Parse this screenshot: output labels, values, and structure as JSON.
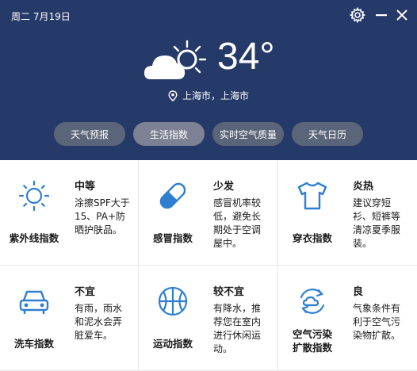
{
  "header": {
    "date": "周二 7月19日",
    "temperature": "34°",
    "location": "上海市，上海市"
  },
  "tabs": [
    {
      "label": "天气预报"
    },
    {
      "label": "生活指数"
    },
    {
      "label": "实时空气质量"
    },
    {
      "label": "天气日历"
    }
  ],
  "indices": [
    {
      "name": "紫外线指数",
      "level": "中等",
      "desc": "涂擦SPF大于15、PA+防晒护肤品。",
      "icon": "sun-icon"
    },
    {
      "name": "感冒指数",
      "level": "少发",
      "desc": "感冒机率较低，避免长期处于空调屋中。",
      "icon": "pill-icon"
    },
    {
      "name": "穿衣指数",
      "level": "炎热",
      "desc": "建议穿短衫、短裤等清凉夏季服装。",
      "icon": "tshirt-icon"
    },
    {
      "name": "洗车指数",
      "level": "不宜",
      "desc": "有雨，雨水和泥水会弄脏爱车。",
      "icon": "car-icon"
    },
    {
      "name": "运动指数",
      "level": "较不宜",
      "desc": "有降水，推荐您在室内进行休闲运动。",
      "icon": "ball-icon"
    },
    {
      "name": "空气污染扩散指数",
      "level": "良",
      "desc": "气象条件有利于空气污染物扩散。",
      "icon": "air-cycle-icon"
    }
  ],
  "colors": {
    "header_bg": "#263a69",
    "icon_blue": "#2f7fd1",
    "tab_bg": "#5b6579",
    "tab_active_bg": "#7c8294"
  }
}
